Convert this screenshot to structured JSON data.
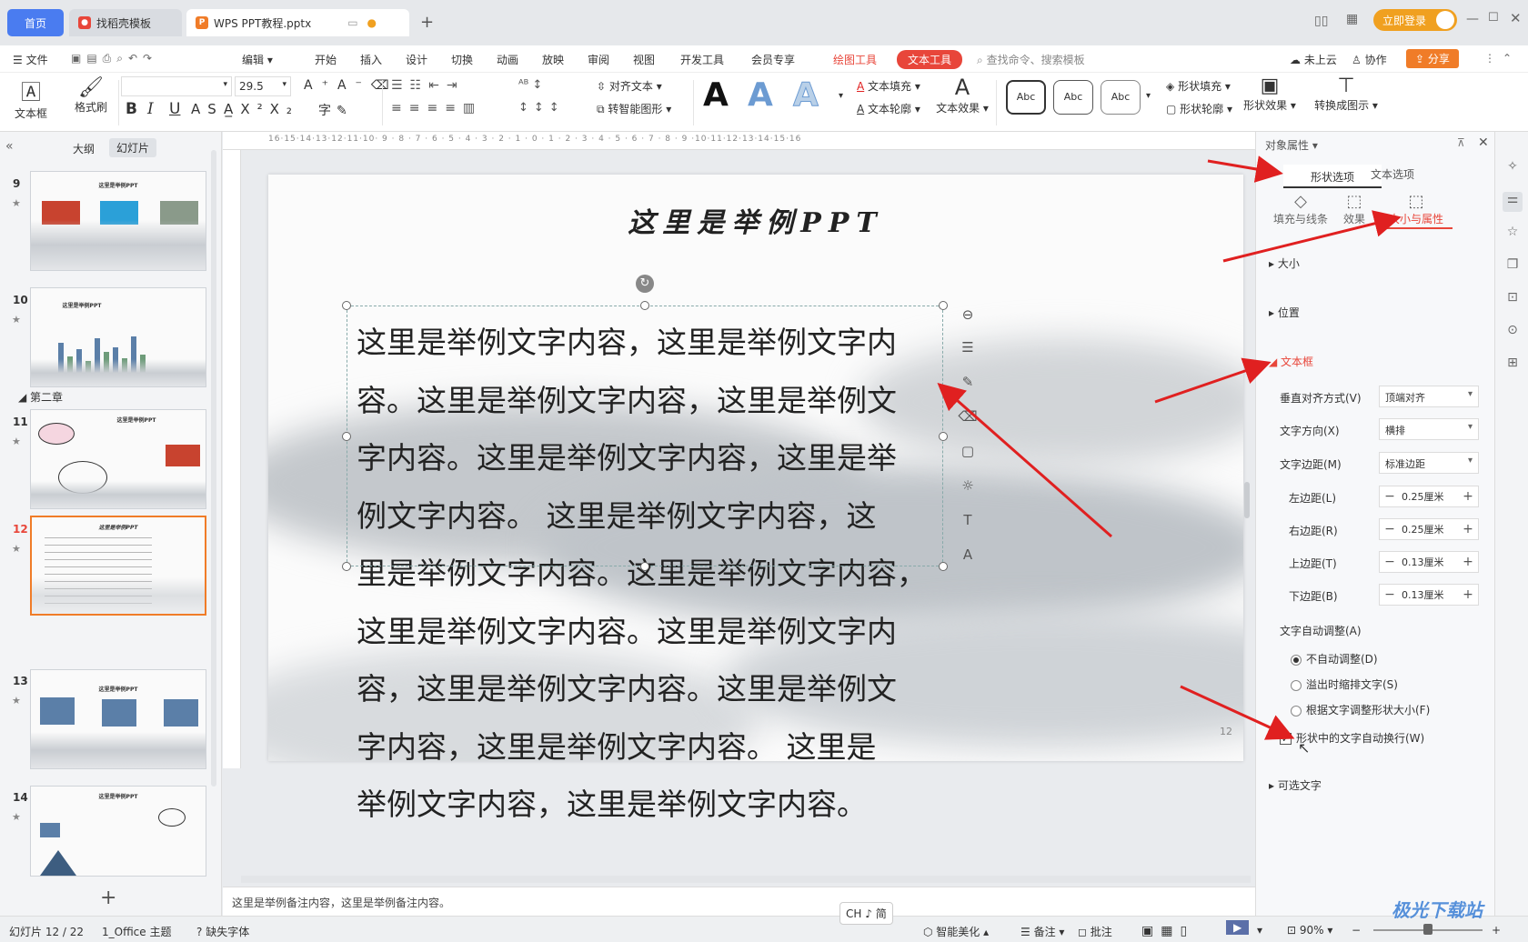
{
  "titlebar": {
    "home_tab": "首页",
    "template_tab": "找稻壳模板",
    "doc_tab": "WPS PPT教程.pptx",
    "new_tab": "+",
    "login_btn": "立即登录"
  },
  "menu": {
    "file": "文件",
    "edit": "编辑",
    "items": [
      "开始",
      "插入",
      "设计",
      "切换",
      "动画",
      "放映",
      "审阅",
      "视图",
      "开发工具",
      "会员专享"
    ],
    "draw_tool": "绘图工具",
    "text_tool": "文本工具",
    "search_placeholder": "查找命令、搜索模板",
    "cloud": "未上云",
    "collab": "协作",
    "share": "分享"
  },
  "toolbar": {
    "textbox": "文本框",
    "format_painter": "格式刷",
    "font_size": "29.5",
    "align_text": "对齐文本",
    "convert_smart": "转智能图形",
    "text_fill": "文本填充",
    "text_outline": "文本轮廓",
    "text_effect": "文本效果",
    "shape_fill": "形状填充",
    "shape_outline": "形状轮廓",
    "shape_effect": "形状效果",
    "convert_diagram": "转换成图示",
    "style_a": "A",
    "abc": "Abc",
    "bold": "B",
    "italic": "I",
    "underline": "U"
  },
  "left_panel": {
    "tab_outline": "大纲",
    "tab_slides": "幻灯片",
    "chapter_label": "第二章",
    "slides": [
      {
        "num": "9",
        "title": "这里是举例PPT"
      },
      {
        "num": "10",
        "title": "这里是举例PPT"
      },
      {
        "num": "11",
        "title": "这里是举例PPT"
      },
      {
        "num": "12",
        "title": "这里是举例PPT",
        "selected": true
      },
      {
        "num": "13",
        "title": "这里是举例PPT"
      },
      {
        "num": "14",
        "title": "这里是举例PPT"
      }
    ],
    "add": "+"
  },
  "slide": {
    "title": "这里是举例PPT",
    "page_num": "12",
    "body_lines": [
      "这里是举例文字内容，这里是举例文字内",
      "容。这里是举例文字内容，这里是举例文",
      "字内容。这里是举例文字内容，这里是举",
      "例文字内容。 这里是举例文字内容，这",
      "里是举例文字内容。这里是举例文字内容，",
      "这里是举例文字内容。这里是举例文字内",
      "容，这里是举例文字内容。这里是举例文",
      "字内容，这里是举例文字内容。 这里是",
      "举例文字内容，这里是举例文字内容。"
    ]
  },
  "notes_text": "这里是举例备注内容，这里是举例备注内容。",
  "right_panel": {
    "header": "对象属性",
    "tab_shape": "形状选项",
    "tab_text": "文本选项",
    "sub_fill": "填充与线条",
    "sub_effect": "效果",
    "sub_size": "大小与属性",
    "sec_size": "大小",
    "sec_position": "位置",
    "sec_textbox": "文本框",
    "valign_label": "垂直对齐方式(V)",
    "valign_value": "顶端对齐",
    "dir_label": "文字方向(X)",
    "dir_value": "横排",
    "margin_label": "文字边距(M)",
    "margin_value": "标准边距",
    "left_label": "左边距(L)",
    "left_value": "0.25厘米",
    "right_label": "右边距(R)",
    "right_value": "0.25厘米",
    "top_label": "上边距(T)",
    "top_value": "0.13厘米",
    "bottom_label": "下边距(B)",
    "bottom_value": "0.13厘米",
    "autofit_label": "文字自动调整(A)",
    "opt_none": "不自动调整(D)",
    "opt_shrink": "溢出时缩排文字(S)",
    "opt_resize": "根据文字调整形状大小(F)",
    "wrap_label": "形状中的文字自动换行(W)",
    "alt_text": "可选文字"
  },
  "status": {
    "slide_info": "幻灯片 12 / 22",
    "theme": "1_Office 主题",
    "missing_font": "缺失字体",
    "ime": "CH ♪ 简",
    "beautify": "智能美化",
    "notes": "备注",
    "comments": "批注",
    "zoom": "90%",
    "watermark": "极光下载站"
  },
  "colors": {
    "accent_blue": "#4a7cf0",
    "text_tool_red": "#e8463a",
    "arrow_red": "#e02020",
    "login_orange": "#f0a020"
  }
}
